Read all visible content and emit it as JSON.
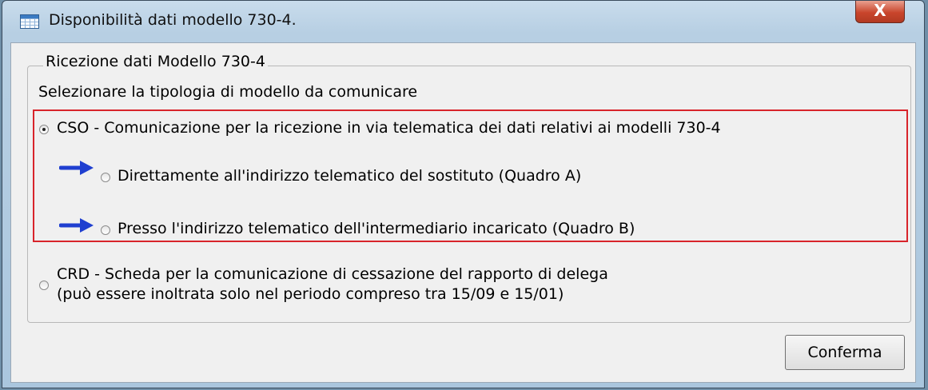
{
  "window": {
    "title": "Disponibilità dati modello 730-4.",
    "close_label": "X"
  },
  "group": {
    "legend": "Ricezione dati Modello 730-4",
    "instruction": "Selezionare la tipologia di modello da comunicare"
  },
  "options": {
    "cso": {
      "label": "CSO - Comunicazione per la ricezione in via telematica dei dati relativi ai modelli 730-4",
      "checked": true
    },
    "quadro_a": {
      "label": "Direttamente all'indirizzo telematico del sostituto (Quadro A)",
      "checked": false
    },
    "quadro_b": {
      "label": "Presso l'indirizzo telematico dell'intermediario incaricato (Quadro B)",
      "checked": false
    },
    "crd": {
      "label_line1": "CRD - Scheda per la comunicazione di cessazione del rapporto di delega",
      "label_line2": "(può essere inoltrata solo nel periodo compreso tra 15/09 e 15/01)",
      "checked": false
    }
  },
  "buttons": {
    "confirm_label": "Conferma"
  },
  "colors": {
    "highlight": "#d8242b",
    "arrow": "#1f3fd0"
  }
}
